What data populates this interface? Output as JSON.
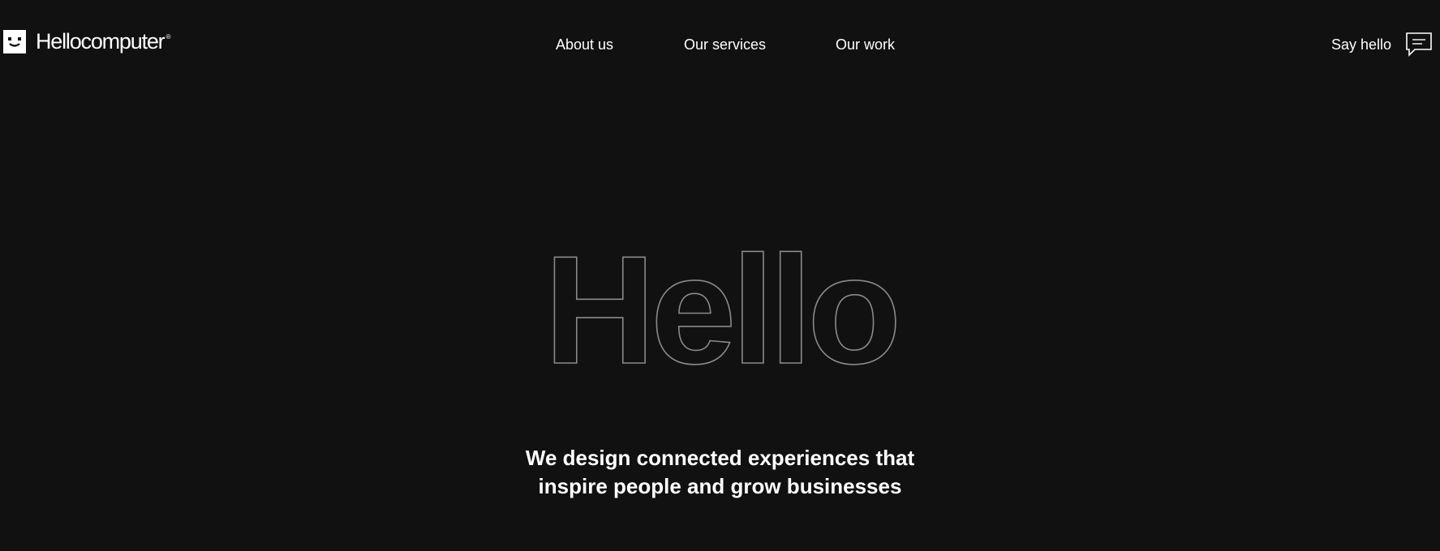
{
  "brand": {
    "name": "Hellocomputer",
    "registered_mark": "®",
    "logo_icon": "smiley-face-square-icon"
  },
  "nav": {
    "items": [
      {
        "label": "About us"
      },
      {
        "label": "Our services"
      },
      {
        "label": "Our work"
      }
    ]
  },
  "cta": {
    "label": "Say hello",
    "icon": "chat-bubble-icon"
  },
  "hero": {
    "headline": "Hello",
    "tagline_line1": "We design connected experiences that",
    "tagline_line2": "inspire people and grow businesses"
  },
  "colors": {
    "background": "#111111",
    "text": "#ffffff",
    "outline": "#8a8a8a"
  }
}
